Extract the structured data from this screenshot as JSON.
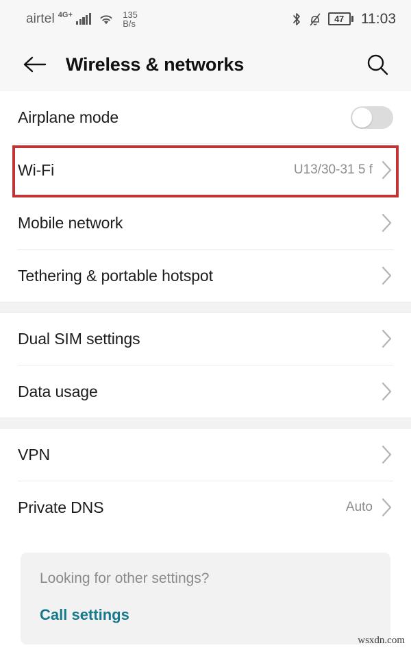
{
  "statusbar": {
    "carrier": "airtel",
    "network_type": "4G+",
    "signal_icon": "signal-bars-icon",
    "wifi_icon": "wifi-icon",
    "data_speed_value": "135",
    "data_speed_unit": "B/s",
    "bluetooth_icon": "bluetooth-icon",
    "silent_icon": "bell-slash-icon",
    "battery_percent": "47",
    "battery_icon": "battery-icon",
    "time": "11:03"
  },
  "appbar": {
    "back_icon": "back-arrow-icon",
    "title": "Wireless & networks",
    "search_icon": "search-icon"
  },
  "groups": [
    {
      "rows": [
        {
          "name": "airplane-mode",
          "label": "Airplane mode",
          "control": "toggle",
          "toggle_on": false,
          "value": ""
        },
        {
          "name": "wi-fi",
          "label": "Wi-Fi",
          "control": "chevron",
          "value": "U13/30-31 5 f",
          "highlighted": true
        },
        {
          "name": "mobile-network",
          "label": "Mobile network",
          "control": "chevron",
          "value": ""
        },
        {
          "name": "tethering-portable-hotspot",
          "label": "Tethering & portable hotspot",
          "control": "chevron",
          "value": ""
        }
      ]
    },
    {
      "rows": [
        {
          "name": "dual-sim-settings",
          "label": "Dual SIM settings",
          "control": "chevron",
          "value": ""
        },
        {
          "name": "data-usage",
          "label": "Data usage",
          "control": "chevron",
          "value": ""
        }
      ]
    },
    {
      "rows": [
        {
          "name": "vpn",
          "label": "VPN",
          "control": "chevron",
          "value": ""
        },
        {
          "name": "private-dns",
          "label": "Private DNS",
          "control": "chevron",
          "value": "Auto"
        }
      ]
    }
  ],
  "footer": {
    "question": "Looking for other settings?",
    "link": "Call settings"
  },
  "watermark": "wsxdn.com",
  "colors": {
    "accent_link": "#16798a",
    "highlight_box": "#bf3434",
    "statusbar_bg": "#f7f7f7",
    "group_gap_bg": "#f2f2f2"
  }
}
